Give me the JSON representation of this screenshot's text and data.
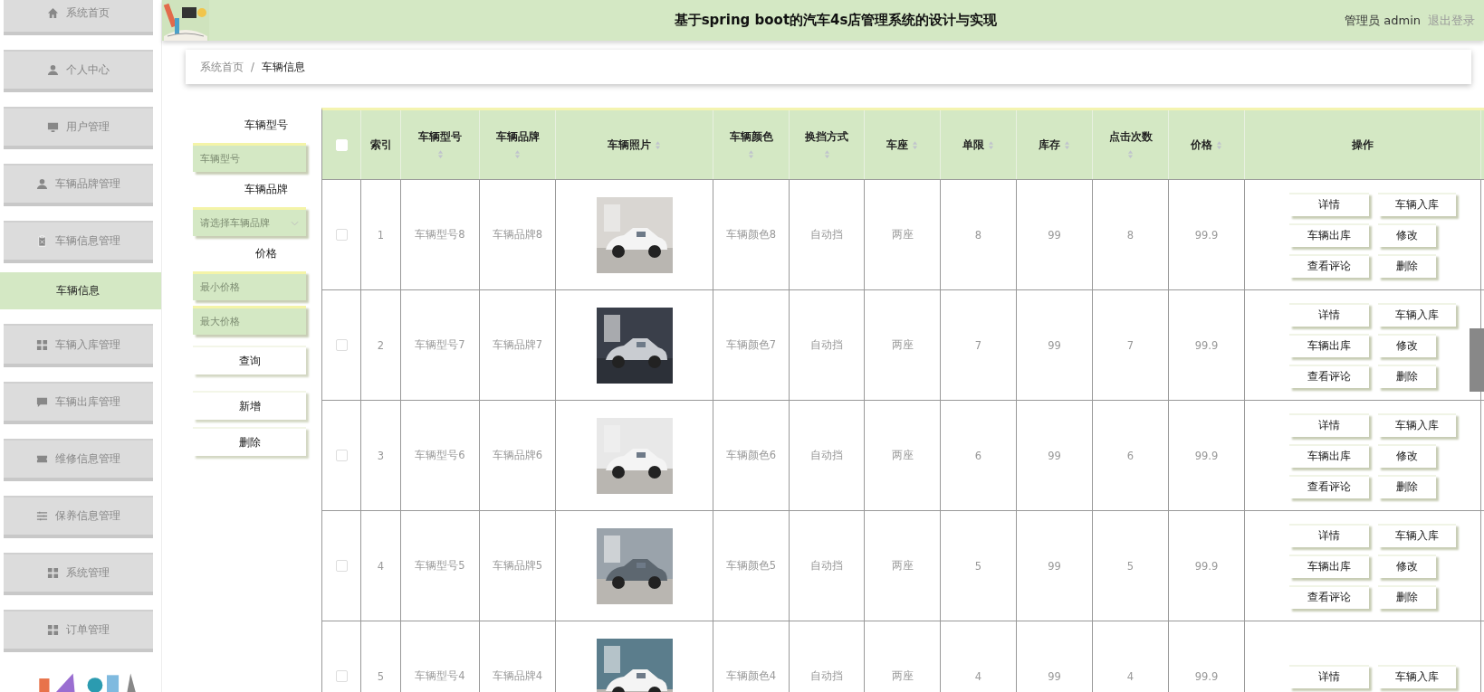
{
  "sidebar": {
    "items": [
      {
        "label": "系统首页",
        "kind": "menu",
        "selected": false
      },
      {
        "label": "个人中心",
        "kind": "menu",
        "selected": false
      },
      {
        "label": "用户管理",
        "kind": "menu",
        "selected": false
      },
      {
        "label": "车辆品牌管理",
        "kind": "menu",
        "selected": false
      },
      {
        "label": "车辆信息管理",
        "kind": "menu",
        "selected": false
      },
      {
        "label": "车辆信息",
        "kind": "sub",
        "selected": true
      },
      {
        "label": "车辆入库管理",
        "kind": "menu",
        "selected": false
      },
      {
        "label": "车辆出库管理",
        "kind": "menu",
        "selected": false
      },
      {
        "label": "维修信息管理",
        "kind": "menu",
        "selected": false
      },
      {
        "label": "保养信息管理",
        "kind": "menu",
        "selected": false
      },
      {
        "label": "系统管理",
        "kind": "menu",
        "selected": false
      },
      {
        "label": "订单管理",
        "kind": "menu",
        "selected": false
      }
    ]
  },
  "header": {
    "title": "基于spring boot的汽车4s店管理系统的设计与实现",
    "user": "管理员 admin",
    "logout": "退出登录"
  },
  "breadcrumb": {
    "items": [
      "系统首页",
      "车辆信息"
    ],
    "separator": "/"
  },
  "filters": [
    {
      "kind": "input",
      "label": "车辆型号",
      "placeholder": "车辆型号"
    },
    {
      "kind": "select",
      "label": "车辆品牌",
      "placeholder": "请选择车辆品牌"
    },
    {
      "kind": "range",
      "label": "价格",
      "placeholders": [
        "最小价格",
        "最大价格"
      ]
    }
  ],
  "filter_buttons": [
    "查询",
    "新增",
    "删除"
  ],
  "table": {
    "select_all": {
      "checked": false
    },
    "columns": [
      {
        "label": "索引"
      },
      {
        "label": "车辆型号"
      },
      {
        "label": "车辆品牌"
      },
      {
        "label": "车辆照片"
      },
      {
        "label": "车辆颜色"
      },
      {
        "label": "换挡方式"
      },
      {
        "label": "车座"
      },
      {
        "label": "单限"
      },
      {
        "label": "库存"
      },
      {
        "label": "点击次数"
      },
      {
        "label": "价格"
      },
      {
        "label": "操作"
      }
    ],
    "rows": [
      {
        "checked": false,
        "cells": [
          "1",
          "车辆型号8",
          "车辆品牌8",
          "",
          "车辆颜色8",
          "自动挡",
          "两座",
          "8",
          "99",
          "8",
          "99.9"
        ],
        "actions": [
          "详情",
          "车辆入库",
          "车辆出库",
          "修改",
          "查看评论",
          "删除"
        ]
      },
      {
        "checked": false,
        "cells": [
          "2",
          "车辆型号7",
          "车辆品牌7",
          "",
          "车辆颜色7",
          "自动挡",
          "两座",
          "7",
          "99",
          "7",
          "99.9"
        ],
        "actions": [
          "详情",
          "车辆入库",
          "车辆出库",
          "修改",
          "查看评论",
          "删除"
        ]
      },
      {
        "checked": false,
        "cells": [
          "3",
          "车辆型号6",
          "车辆品牌6",
          "",
          "车辆颜色6",
          "自动挡",
          "两座",
          "6",
          "99",
          "6",
          "99.9"
        ],
        "actions": [
          "详情",
          "车辆入库",
          "车辆出库",
          "修改",
          "查看评论",
          "删除"
        ]
      },
      {
        "checked": false,
        "cells": [
          "4",
          "车辆型号5",
          "车辆品牌5",
          "",
          "车辆颜色5",
          "自动挡",
          "两座",
          "5",
          "99",
          "5",
          "99.9"
        ],
        "actions": [
          "详情",
          "车辆入库",
          "车辆出库",
          "修改",
          "查看评论",
          "删除"
        ]
      },
      {
        "checked": false,
        "cells": [
          "5",
          "车辆型号4",
          "车辆品牌4",
          "",
          "车辆颜色4",
          "自动挡",
          "两座",
          "4",
          "99",
          "4",
          "99.9"
        ],
        "actions": [
          "详情",
          "车辆入库"
        ]
      }
    ]
  }
}
